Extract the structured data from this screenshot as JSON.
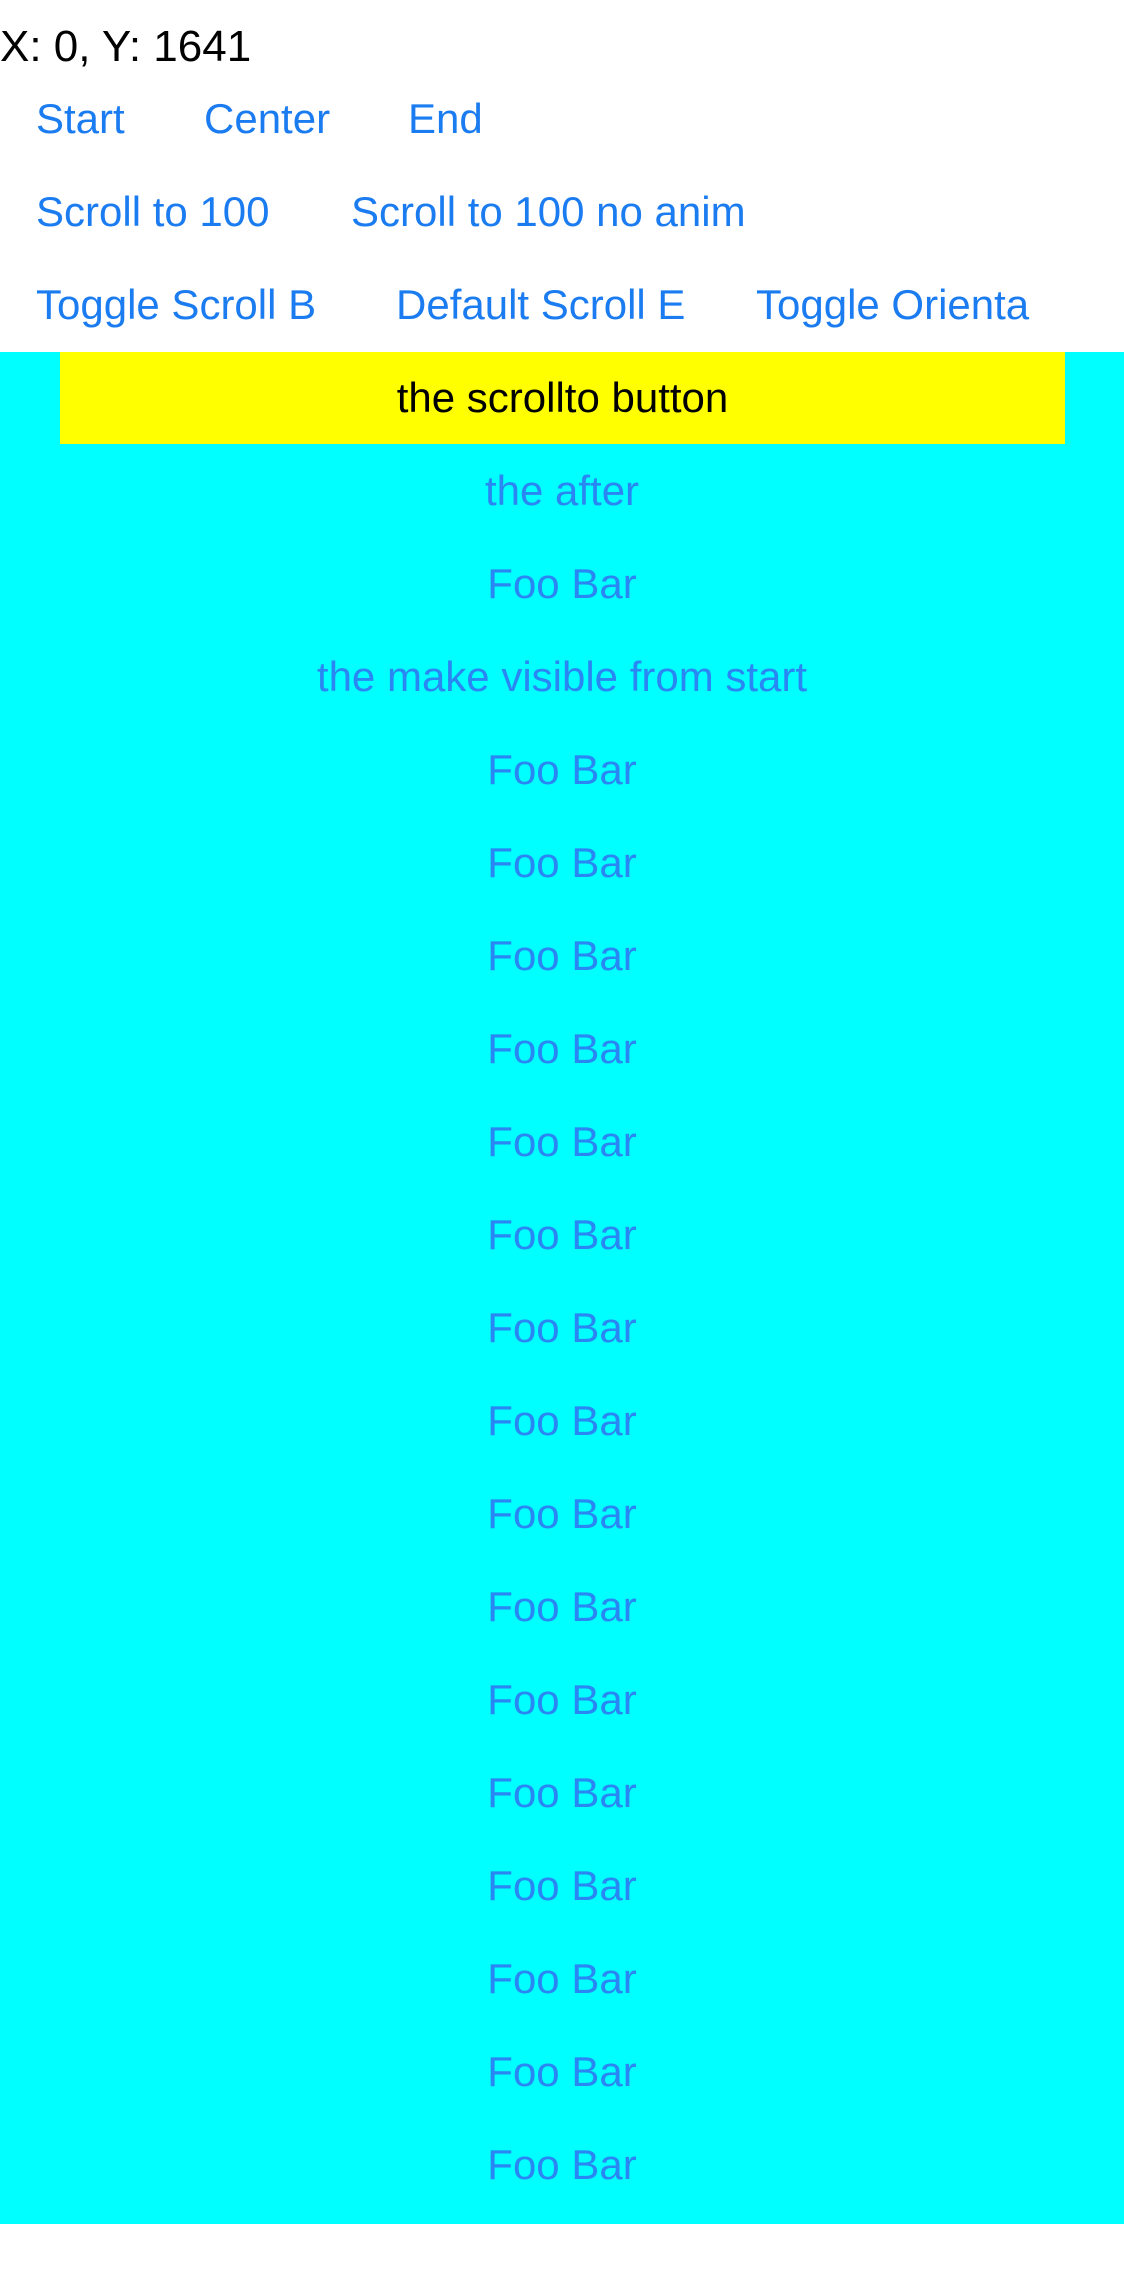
{
  "status": {
    "coordinates": "X: 0, Y: 1641"
  },
  "buttons": {
    "start": "Start",
    "center": "Center",
    "end": "End",
    "scroll_to_100": "Scroll to 100",
    "scroll_to_100_no_anim": "Scroll to 100 no anim",
    "toggle_scroll_bar": "Toggle Scroll B",
    "default_scroll_bar": "Default Scroll E",
    "toggle_orientation": "Toggle Orienta"
  },
  "scroll_view": {
    "scrollto_button": "the scrollto button",
    "items": [
      "the after",
      "Foo Bar",
      "the make visible from start",
      "Foo Bar",
      "Foo Bar",
      "Foo Bar",
      "Foo Bar",
      "Foo Bar",
      "Foo Bar",
      "Foo Bar",
      "Foo Bar",
      "Foo Bar",
      "Foo Bar",
      "Foo Bar",
      "Foo Bar",
      "Foo Bar",
      "Foo Bar",
      "Foo Bar",
      "Foo Bar"
    ]
  },
  "colors": {
    "link_blue": "#1a7cf0",
    "scroll_background": "#00ffff",
    "highlight_yellow": "#ffff00"
  }
}
